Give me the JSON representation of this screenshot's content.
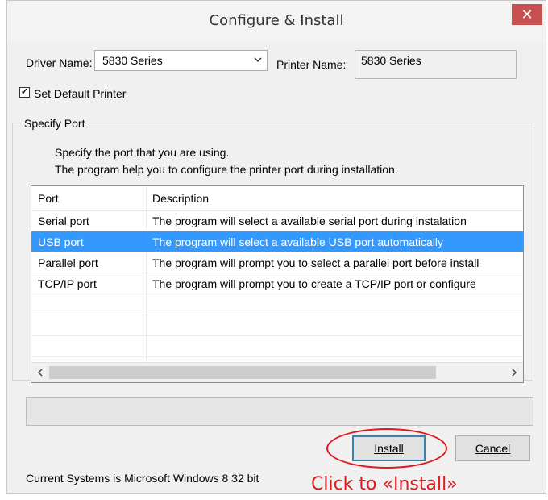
{
  "window": {
    "title": "Configure & Install",
    "close_glyph": "✕"
  },
  "driver": {
    "label": "Driver Name:",
    "value": "5830 Series",
    "arrow_icon": "chevron-down-icon"
  },
  "printer": {
    "label": "Printer Name:",
    "value": "5830 Series"
  },
  "default_printer": {
    "label": "Set Default Printer",
    "checked": true
  },
  "specify_port": {
    "legend": "Specify Port",
    "hint_line1": "Specify the port that you are using.",
    "hint_line2": "The program help you to configure the printer port during installation.",
    "columns": [
      "Port",
      "Description"
    ],
    "rows": [
      {
        "port": "Serial port",
        "description": "The program will select a available serial port during instalation",
        "selected": false
      },
      {
        "port": "USB port",
        "description": "The program will select a available USB port automatically",
        "selected": true
      },
      {
        "port": "Parallel port",
        "description": "The program will prompt you to select a parallel port before install",
        "selected": false
      },
      {
        "port": "TCP/IP port",
        "description": "The program will prompt you to create a TCP/IP port or configure",
        "selected": false
      }
    ]
  },
  "buttons": {
    "install_label": "Install",
    "cancel_label": "Cancel"
  },
  "status": {
    "system_text": "Current Systems is Microsoft Windows 8  32 bit"
  },
  "annotation": {
    "text": "Click to «Install»",
    "color": "#e0191e"
  },
  "colors": {
    "selection": "#3399ff",
    "close_button": "#c75050"
  }
}
